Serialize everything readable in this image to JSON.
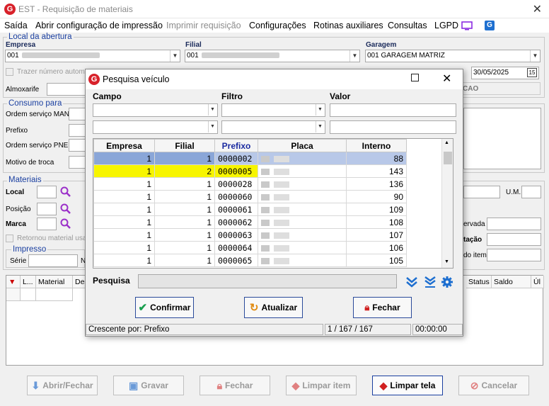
{
  "window": {
    "title": "EST - Requisição de materiais",
    "close_glyph": "✕"
  },
  "menu": [
    "Saída",
    "Abrir configuração de impressão",
    "Imprimir requisição",
    "Configurações",
    "Rotinas auxiliares",
    "Consultas",
    "LGPD"
  ],
  "local_abertura": {
    "group_label": "Local da abertura",
    "empresa_label": "Empresa",
    "empresa_value": "001",
    "filial_label": "Filial",
    "filial_value": "001",
    "garagem_label": "Garagem",
    "garagem_value": "001 GARAGEM MATRIZ",
    "trazer_label": "Trazer número automa",
    "date_value": "30/05/2025",
    "almoxarife_label": "Almoxarife",
    "cao_text": "CAO"
  },
  "consumo": {
    "group_label": "Consumo para",
    "os_man_label": "Ordem serviço MAN",
    "prefixo_label": "Prefixo",
    "os_pne_label": "Ordem serviço PNE",
    "motivo_label": "Motivo de troca"
  },
  "materiais": {
    "group_label": "Materiais",
    "local_label": "Local",
    "posicao_label": "Posição",
    "marca_label": "Marca",
    "retornou_label": "Retornou material usad",
    "um_label": "U.M.",
    "reservada_label": "ervada",
    "cotacao_label": "tação",
    "do_item_label": "do item",
    "impresso_label": "Impresso",
    "serie_label": "Série",
    "n_label": "N"
  },
  "lower_grid_headers": [
    "L...",
    "Material",
    "Des",
    "Status",
    "Saldo",
    "Úl"
  ],
  "bottom_buttons": {
    "abrir": "Abrir/Fechar",
    "gravar": "Gravar",
    "fechar": "Fechar",
    "limpar_item": "Limpar item",
    "limpar_tela": "Limpar tela",
    "cancelar": "Cancelar"
  },
  "dialog": {
    "title": "Pesquisa veículo",
    "campo_label": "Campo",
    "filtro_label": "Filtro",
    "valor_label": "Valor",
    "columns": [
      "Empresa",
      "Filial",
      "Prefixo",
      "Placa",
      "Interno"
    ],
    "rows": [
      {
        "empresa": "1",
        "filial": "1",
        "prefixo": "0000002",
        "interno": "88"
      },
      {
        "empresa": "1",
        "filial": "2",
        "prefixo": "0000005",
        "interno": "143"
      },
      {
        "empresa": "1",
        "filial": "1",
        "prefixo": "0000028",
        "interno": "136"
      },
      {
        "empresa": "1",
        "filial": "1",
        "prefixo": "0000060",
        "interno": "90"
      },
      {
        "empresa": "1",
        "filial": "1",
        "prefixo": "0000061",
        "interno": "109"
      },
      {
        "empresa": "1",
        "filial": "1",
        "prefixo": "0000062",
        "interno": "108"
      },
      {
        "empresa": "1",
        "filial": "1",
        "prefixo": "0000063",
        "interno": "107"
      },
      {
        "empresa": "1",
        "filial": "1",
        "prefixo": "0000064",
        "interno": "106"
      },
      {
        "empresa": "1",
        "filial": "1",
        "prefixo": "0000065",
        "interno": "105"
      }
    ],
    "pesquisa_label": "Pesquisa",
    "confirmar_label": "Confirmar",
    "atualizar_label": "Atualizar",
    "fechar_label": "Fechar",
    "status_order": "Crescente por: Prefixo",
    "status_count": "1 / 167 / 167",
    "status_time": "00:00:00"
  }
}
